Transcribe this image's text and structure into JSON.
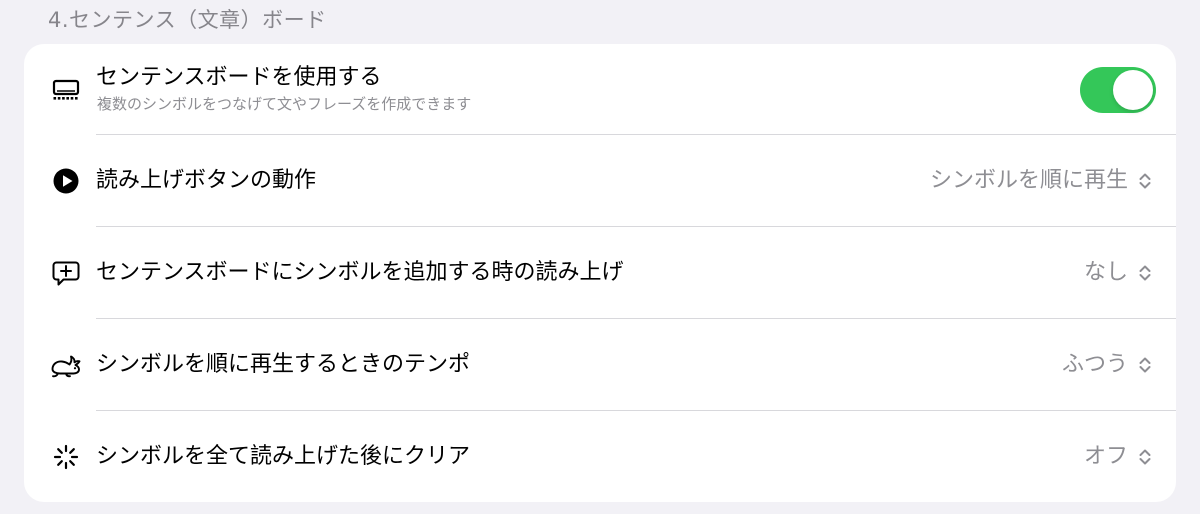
{
  "section": {
    "header": "4.センテンス（文章）ボード"
  },
  "colors": {
    "background": "#f2f1f6",
    "card": "#ffffff",
    "toggle_on": "#34c759",
    "secondary_text": "#8e8e93"
  },
  "settings": [
    {
      "icon": "keyboard-icon",
      "title": "センテンスボードを使用する",
      "subtitle": "複数のシンボルをつなげて文やフレーズを作成できます",
      "control": "toggle",
      "toggle_on": true
    },
    {
      "icon": "play-circle-icon",
      "title": "読み上げボタンの動作",
      "control": "popup",
      "value": "シンボルを順に再生"
    },
    {
      "icon": "speech-bubble-plus-icon",
      "title": "センテンスボードにシンボルを追加する時の読み上げ",
      "control": "popup",
      "value": "なし"
    },
    {
      "icon": "rabbit-icon",
      "title": "シンボルを順に再生するときのテンポ",
      "control": "popup",
      "value": "ふつう"
    },
    {
      "icon": "spinner-icon",
      "title": "シンボルを全て読み上げた後にクリア",
      "control": "popup",
      "value": "オフ"
    }
  ]
}
